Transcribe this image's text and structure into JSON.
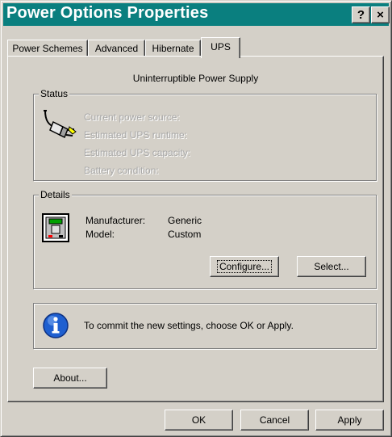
{
  "window": {
    "title": "Power Options Properties",
    "help_label": "?",
    "close_label": "×"
  },
  "tabs": [
    {
      "label": "Power Schemes",
      "active": false
    },
    {
      "label": "Advanced",
      "active": false
    },
    {
      "label": "Hibernate",
      "active": false
    },
    {
      "label": "UPS",
      "active": true
    }
  ],
  "ups": {
    "heading": "Uninterruptible Power Supply",
    "status": {
      "legend": "Status",
      "lines": [
        "Current power source:",
        "Estimated UPS runtime:",
        "Estimated UPS capacity:",
        "Battery condition:"
      ]
    },
    "details": {
      "legend": "Details",
      "manufacturer_label": "Manufacturer:",
      "manufacturer_value": "Generic",
      "model_label": "Model:",
      "model_value": "Custom",
      "configure_label": "Configure...",
      "select_label": "Select..."
    },
    "info_text": "To commit the new settings, choose OK or Apply.",
    "about_label": "About..."
  },
  "footer": {
    "ok_label": "OK",
    "cancel_label": "Cancel",
    "apply_label": "Apply"
  },
  "colors": {
    "titlebar": "#0a7f7f",
    "face": "#d4d0c8",
    "disabled_text": "#a8a8a8"
  }
}
